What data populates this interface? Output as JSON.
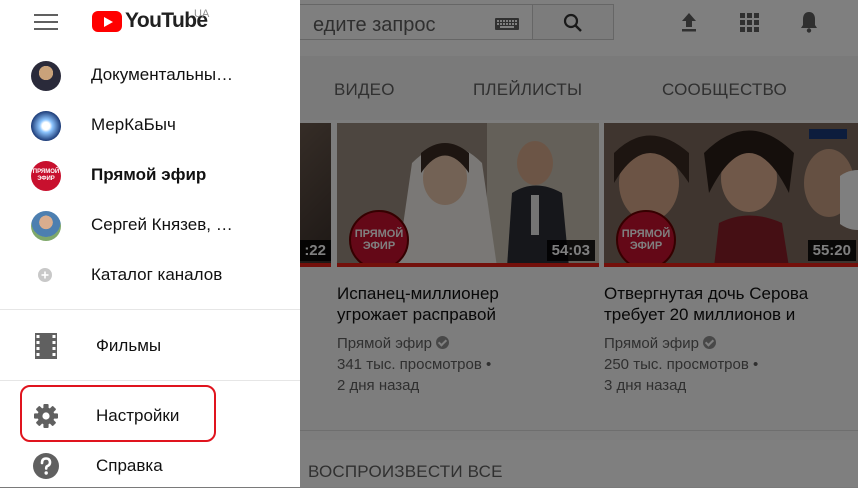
{
  "header": {
    "logo_text": "YouTube",
    "logo_region": "UA",
    "search_placeholder": "едите запрос"
  },
  "tabs": [
    {
      "label": "ВИДЕО"
    },
    {
      "label": "ПЛЕЙЛИСТЫ"
    },
    {
      "label": "СООБЩЕСТВО"
    }
  ],
  "videos": [
    {
      "duration": ":22"
    },
    {
      "duration": "54:03",
      "badge": "ПРЯМОЙ ЭФИР",
      "title_line1": "Испанец-миллионер",
      "title_line2": "угрожает расправой",
      "channel": "Прямой эфир",
      "views": "341 тыс. просмотров •",
      "age": "2 дня назад"
    },
    {
      "duration": "55:20",
      "badge": "ПРЯМОЙ ЭФИР",
      "title_line1": "Отвергнутая дочь Серова",
      "title_line2": "требует 20 миллионов и",
      "channel": "Прямой эфир",
      "views": "250 тыс. просмотров •",
      "age": "3 дня назад"
    }
  ],
  "play_all_label": "ВОСПРОИЗВЕСТИ ВСЕ",
  "drawer": {
    "subscriptions": [
      {
        "label": "Документальны…"
      },
      {
        "label": "МерКаБыч"
      },
      {
        "label": "Прямой эфир",
        "avatar_text": "ПРЯМОЙ ЭФИР"
      },
      {
        "label": "Сергей Князев, …"
      },
      {
        "label": "Каталог каналов"
      }
    ],
    "films_label": "Фильмы",
    "settings_label": "Настройки",
    "help_label": "Справка"
  },
  "colors": {
    "brand_red": "#ff0000",
    "progress_red": "#e62117",
    "highlight_red": "#e0141e",
    "badge_red": "#c8102e"
  }
}
